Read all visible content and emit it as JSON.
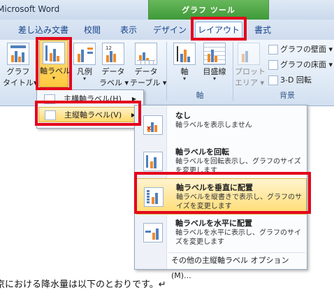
{
  "app": {
    "title": "Microsoft Word",
    "context_group": "グラフ ツール"
  },
  "tabs": [
    {
      "label": "差し込み文書",
      "active": false
    },
    {
      "label": "校閲",
      "active": false
    },
    {
      "label": "表示",
      "active": false
    },
    {
      "label": "デザイン",
      "active": false
    },
    {
      "label": "レイアウト",
      "active": true
    },
    {
      "label": "書式",
      "active": false
    }
  ],
  "ribbon": {
    "buttons": {
      "graph_title": {
        "line1": "グラフ",
        "line2": "タイトル▾"
      },
      "axis_label": {
        "line1": "軸ラベル",
        "arrow": "▾"
      },
      "legend": {
        "line1": "凡例",
        "arrow": "▾"
      },
      "data_label": {
        "line1": "データ",
        "line2": "ラベル ▾"
      },
      "data_table": {
        "line1": "データ",
        "line2": "テーブル ▾"
      },
      "axis": {
        "line1": "軸",
        "arrow": "▾"
      },
      "gridlines": {
        "line1": "目盛線",
        "arrow": "▾"
      },
      "plot_area": {
        "line1": "プロット",
        "line2": "エリア ▾"
      }
    },
    "small_buttons": {
      "chart_wall": "グラフの壁面 ▾",
      "chart_floor": "グラフの床面 ▾",
      "rotate_3d": "3-D 回転"
    },
    "groups": {
      "axes": "軸",
      "background": "背景"
    }
  },
  "menu1": {
    "items": [
      {
        "label": "主横軸ラベル(H)",
        "highlighted": false
      },
      {
        "label": "主縦軸ラベル(V)",
        "highlighted": true
      }
    ]
  },
  "menu2": {
    "items": [
      {
        "title": "なし",
        "desc": "軸ラベルを表示しません",
        "highlighted": false
      },
      {
        "title": "軸ラベルを回転",
        "desc": "軸ラベルを回転表示し、グラフのサイズを変更します",
        "highlighted": false
      },
      {
        "title": "軸ラベルを垂直に配置",
        "desc": "軸ラベルを縦書きで表示し、グラフのサイズを変更します",
        "highlighted": true
      },
      {
        "title": "軸ラベルを水平に配置",
        "desc": "軸ラベルを水平に表示し、グラフのサイズを変更します",
        "highlighted": false
      }
    ],
    "footer": "その他の主縦軸ラベル オプション(M)..."
  },
  "document": {
    "text": "京における降水量は以下のとおりです。↵"
  },
  "colors": {
    "highlight_box": "#e4001b",
    "menu_hover": "#ffd96b",
    "tab_text": "#15428b"
  }
}
